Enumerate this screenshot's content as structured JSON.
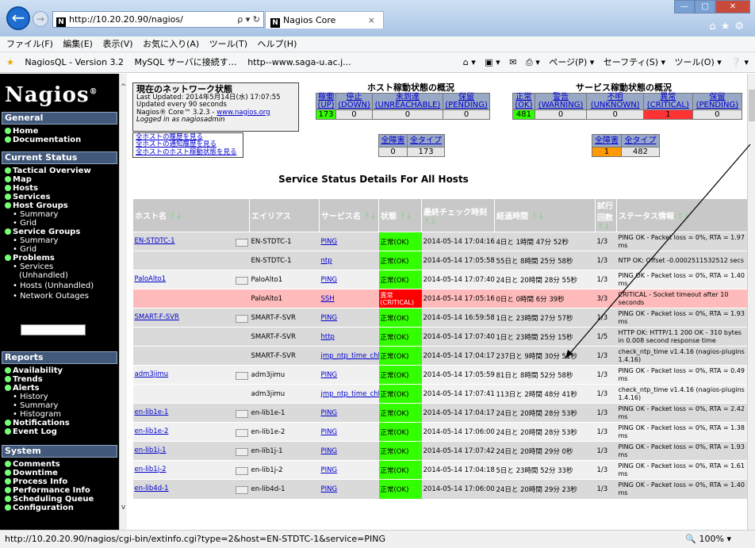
{
  "browser": {
    "address": "http://10.20.20.90/nagios/",
    "address_controls": "ρ ▾ ↻",
    "tab_title": "Nagios Core",
    "tab_close": "×",
    "nagios_letter": "N",
    "menu": [
      "ファイル(F)",
      "編集(E)",
      "表示(V)",
      "お気に入り(A)",
      "ツール(T)",
      "ヘルプ(H)"
    ],
    "favorites": [
      "NagiosQL - Version 3.2",
      "MySQL サーバに接続す…",
      "http--www.saga-u.ac.j..."
    ],
    "fav_right": [
      "ページ(P) ▾",
      "セーフティ(S) ▾",
      "ツール(O) ▾"
    ],
    "status_url": "http://10.20.20.90/nagios/cgi-bin/extinfo.cgi?type=2&host=EN-STDTC-1&service=PING",
    "zoom": "100%"
  },
  "sidebar": {
    "logo": "Nagios",
    "logo_mark": "®",
    "general": "General",
    "home": "Home",
    "documentation": "Documentation",
    "current_status": "Current Status",
    "tactical": "Tactical Overview",
    "map": "Map",
    "hosts": "Hosts",
    "services": "Services",
    "host_groups": "Host Groups",
    "hg_summary": "Summary",
    "hg_grid": "Grid",
    "service_groups": "Service Groups",
    "sg_summary": "Summary",
    "sg_grid": "Grid",
    "problems": "Problems",
    "p_services": "Services",
    "p_unhandled": "(Unhandled)",
    "p_hosts": "Hosts (Unhandled)",
    "p_outages": "Network Outages",
    "reports": "Reports",
    "availability": "Availability",
    "trends": "Trends",
    "alerts": "Alerts",
    "a_history": "History",
    "a_summary": "Summary",
    "a_histogram": "Histogram",
    "notifications": "Notifications",
    "eventlog": "Event Log",
    "system": "System",
    "comments": "Comments",
    "downtime": "Downtime",
    "process_info": "Process Info",
    "perf_info": "Performance Info",
    "sched_queue": "Scheduling Queue",
    "configuration": "Configuration"
  },
  "netstatus": {
    "title": "現在のネットワーク状態",
    "updated": "Last Updated: 2014年5月14日(水) 17:07:55",
    "interval": "Updated every 90 seconds",
    "version_prefix": "Nagios® Core™ 3.2.3 - ",
    "version_link": "www.nagios.org",
    "logged": "Logged in as nagiosadmin",
    "link1": "全ホストの履歴を見る",
    "link2": "全ホストの通知履歴を見る",
    "link3": "全ホストのホスト稼動状態を見る"
  },
  "host_totals": {
    "title": "ホスト稼動状態の概況",
    "headers": [
      "稼働\n(UP)",
      "停止\n(DOWN)",
      "未到達\n(UNREACHABLE)",
      "保留\n(PENDING)"
    ],
    "values": [
      "173",
      "0",
      "0",
      "0"
    ],
    "sub_headers": [
      "全障害",
      "全タイプ"
    ],
    "sub_values": [
      "0",
      "173"
    ]
  },
  "service_totals": {
    "title": "サービス稼動状態の概況",
    "headers": [
      "正常\n(OK)",
      "警告\n(WARNING)",
      "不明\n(UNKNOWN)",
      "異常\n(CRITICAL)",
      "保留\n(PENDING)"
    ],
    "values": [
      "481",
      "0",
      "0",
      "1",
      "0"
    ],
    "sub_headers": [
      "全障害",
      "全タイプ"
    ],
    "sub_values": [
      "1",
      "482"
    ]
  },
  "details": {
    "title": "Service Status Details For All Hosts",
    "columns": [
      "ホスト名",
      "エイリアス",
      "サービス名",
      "状態",
      "最終チェック時刻",
      "経過時間",
      "試行回数",
      "ステータス情報"
    ],
    "rows": [
      {
        "host": "EN-STDTC-1",
        "alias": "EN-STDTC-1",
        "service": "PING",
        "state": "正常(OK)",
        "last": "2014-05-14 17:04:16",
        "dur": "4日と 1時間 47分 52秒",
        "att": "1/3",
        "info": "PING OK - Packet loss = 0%, RTA = 1.97 ms"
      },
      {
        "host": "",
        "alias": "EN-STDTC-1",
        "service": "ntp",
        "state": "正常(OK)",
        "last": "2014-05-14 17:05:58",
        "dur": "55日と 8時間 25分 58秒",
        "att": "1/3",
        "info": "NTP OK: Offset -0.0002511532512 secs"
      },
      {
        "host": "PaloAlto1",
        "alias": "PaloAlto1",
        "service": "PING",
        "state": "正常(OK)",
        "last": "2014-05-14 17:07:40",
        "dur": "24日と 20時間 28分 55秒",
        "att": "1/3",
        "info": "PING OK - Packet loss = 0%, RTA = 1.40 ms"
      },
      {
        "host": "",
        "alias": "PaloAlto1",
        "service": "SSH",
        "state": "異常\n(CRITICAL)",
        "last": "2014-05-14 17:05:16",
        "dur": "0日と 0時間 6分 39秒",
        "att": "3/3",
        "info": "CRITICAL - Socket timeout after 10 seconds"
      },
      {
        "host": "SMART-F-SVR",
        "alias": "SMART-F-SVR",
        "service": "PING",
        "state": "正常(OK)",
        "last": "2014-05-14 16:59:58",
        "dur": "1日と 23時間 27分 57秒",
        "att": "1/3",
        "info": "PING OK - Packet loss = 0%, RTA = 1.93 ms"
      },
      {
        "host": "",
        "alias": "SMART-F-SVR",
        "service": "http",
        "state": "正常(OK)",
        "last": "2014-05-14 17:07:40",
        "dur": "1日と 23時間 25分 15秒",
        "att": "1/5",
        "info": "HTTP OK: HTTP/1.1 200 OK - 310 bytes in 0.008 second response time"
      },
      {
        "host": "",
        "alias": "SMART-F-SVR",
        "service": "jmp_ntp_time_chk",
        "state": "正常(OK)",
        "last": "2014-05-14 17:04:17",
        "dur": "237日と 9時間 30分 51秒",
        "att": "1/3",
        "info": "check_ntp_time v1.4.16 (nagios-plugins 1.4.16)"
      },
      {
        "host": "adm3jimu",
        "alias": "adm3jimu",
        "service": "PING",
        "state": "正常(OK)",
        "last": "2014-05-14 17:05:59",
        "dur": "81日と 8時間 52分 58秒",
        "att": "1/3",
        "info": "PING OK - Packet loss = 0%, RTA = 0.49 ms"
      },
      {
        "host": "",
        "alias": "adm3jimu",
        "service": "jmp_ntp_time_chk",
        "state": "正常(OK)",
        "last": "2014-05-14 17:07:41",
        "dur": "113日と 2時間 48分 41秒",
        "att": "1/3",
        "info": "check_ntp_time v1.4.16 (nagios-plugins 1.4.16)"
      },
      {
        "host": "en-lib1e-1",
        "alias": "en-lib1e-1",
        "service": "PING",
        "state": "正常(OK)",
        "last": "2014-05-14 17:04:17",
        "dur": "24日と 20時間 28分 53秒",
        "att": "1/3",
        "info": "PING OK - Packet loss = 0%, RTA = 2.42 ms"
      },
      {
        "host": "en-lib1e-2",
        "alias": "en-lib1e-2",
        "service": "PING",
        "state": "正常(OK)",
        "last": "2014-05-14 17:06:00",
        "dur": "24日と 20時間 28分 53秒",
        "att": "1/3",
        "info": "PING OK - Packet loss = 0%, RTA = 1.38 ms"
      },
      {
        "host": "en-lib1j-1",
        "alias": "en-lib1j-1",
        "service": "PING",
        "state": "正常(OK)",
        "last": "2014-05-14 17:07:42",
        "dur": "24日と 20時間 29分 0秒",
        "att": "1/3",
        "info": "PING OK - Packet loss = 0%, RTA = 1.93 ms"
      },
      {
        "host": "en-lib1j-2",
        "alias": "en-lib1j-2",
        "service": "PING",
        "state": "正常(OK)",
        "last": "2014-05-14 17:04:18",
        "dur": "5日と 23時間 52分 33秒",
        "att": "1/3",
        "info": "PING OK - Packet loss = 0%, RTA = 1.61 ms"
      },
      {
        "host": "en-lib4d-1",
        "alias": "en-lib4d-1",
        "service": "PING",
        "state": "正常(OK)",
        "last": "2014-05-14 17:06:00",
        "dur": "24日と 20時間 29分 23秒",
        "att": "1/3",
        "info": "PING OK - Packet loss = 0%, RTA = 1.40 ms"
      }
    ]
  },
  "colors": {
    "ok": "#33ff00",
    "critical": "#ff0000",
    "warning_orange": "#ff9900",
    "sidebar_header": "#43597a"
  }
}
